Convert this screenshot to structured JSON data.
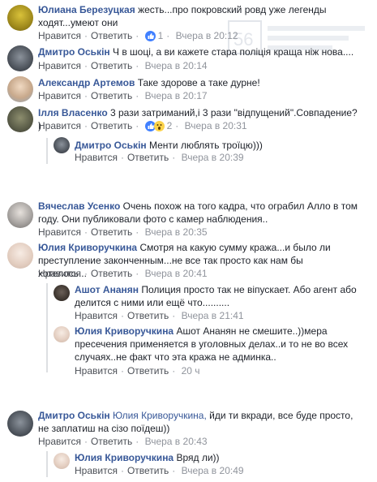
{
  "ui": {
    "like": "Нравится",
    "reply": "Ответить"
  },
  "comments": [
    {
      "author": "Юлиана Березуцкая",
      "text": "жесть...про покровский ровд уже легенды ходят...умеют они",
      "reactions": "1",
      "time": "Вчера в 20:12"
    },
    {
      "author": "Дмитро Оськін",
      "text": "Ч в шоці, а ви кажете стара поліція краща ніж нова....",
      "time": "Вчера в 20:14"
    },
    {
      "author": "Александр Артемов",
      "text": "Таке здорове а таке дурне!",
      "time": "Вчера в 20:17"
    },
    {
      "author": "Ілля Власенко",
      "text": "3 рази затриманий,і 3 рази \"відпущений\".Совпадение? )",
      "reactions": "2",
      "time": "Вчера в 20:31"
    },
    {
      "author": "Дмитро Оськін",
      "text": "Менти люблять троїцю)))",
      "time": "Вчера в 20:39"
    },
    {
      "author": "Вячеслав Усенко",
      "text": "Очень похож на того кадра, что ограбил Алло в том году. Они публиковали фото с камер наблюдения..",
      "time": "Вчера в 20:35"
    },
    {
      "author": "Юлия Криворучкина",
      "text": "Смотря на какую сумму кража...и было ли преступление законченным...не все так просто как нам бы хотелось...",
      "time": "Вчера в 20:41"
    },
    {
      "author": "Ашот Ананян",
      "text": "Полиция просто так не віпускает. Або агент або делится с ними или ещё что..........",
      "time": "Вчера в 21:41"
    },
    {
      "author": "Юлия Криворучкина",
      "text": "Ашот Ананян не смешите..))мера пресечения применяется в уголовных делах..и то не во всех случаях..не факт что эта кража не админка..",
      "time": "20 ч"
    },
    {
      "author": "Дмитро Оськін",
      "mention": "Юлия Криворучкина,",
      "text": "йди ти вкради, все буде просто, не заплатиш на сізо поїдеш))",
      "time": "Вчера в 20:43"
    },
    {
      "author": "Юлия Криворучкина",
      "text": "Вряд ли))",
      "time": "Вчера в 20:49"
    }
  ]
}
